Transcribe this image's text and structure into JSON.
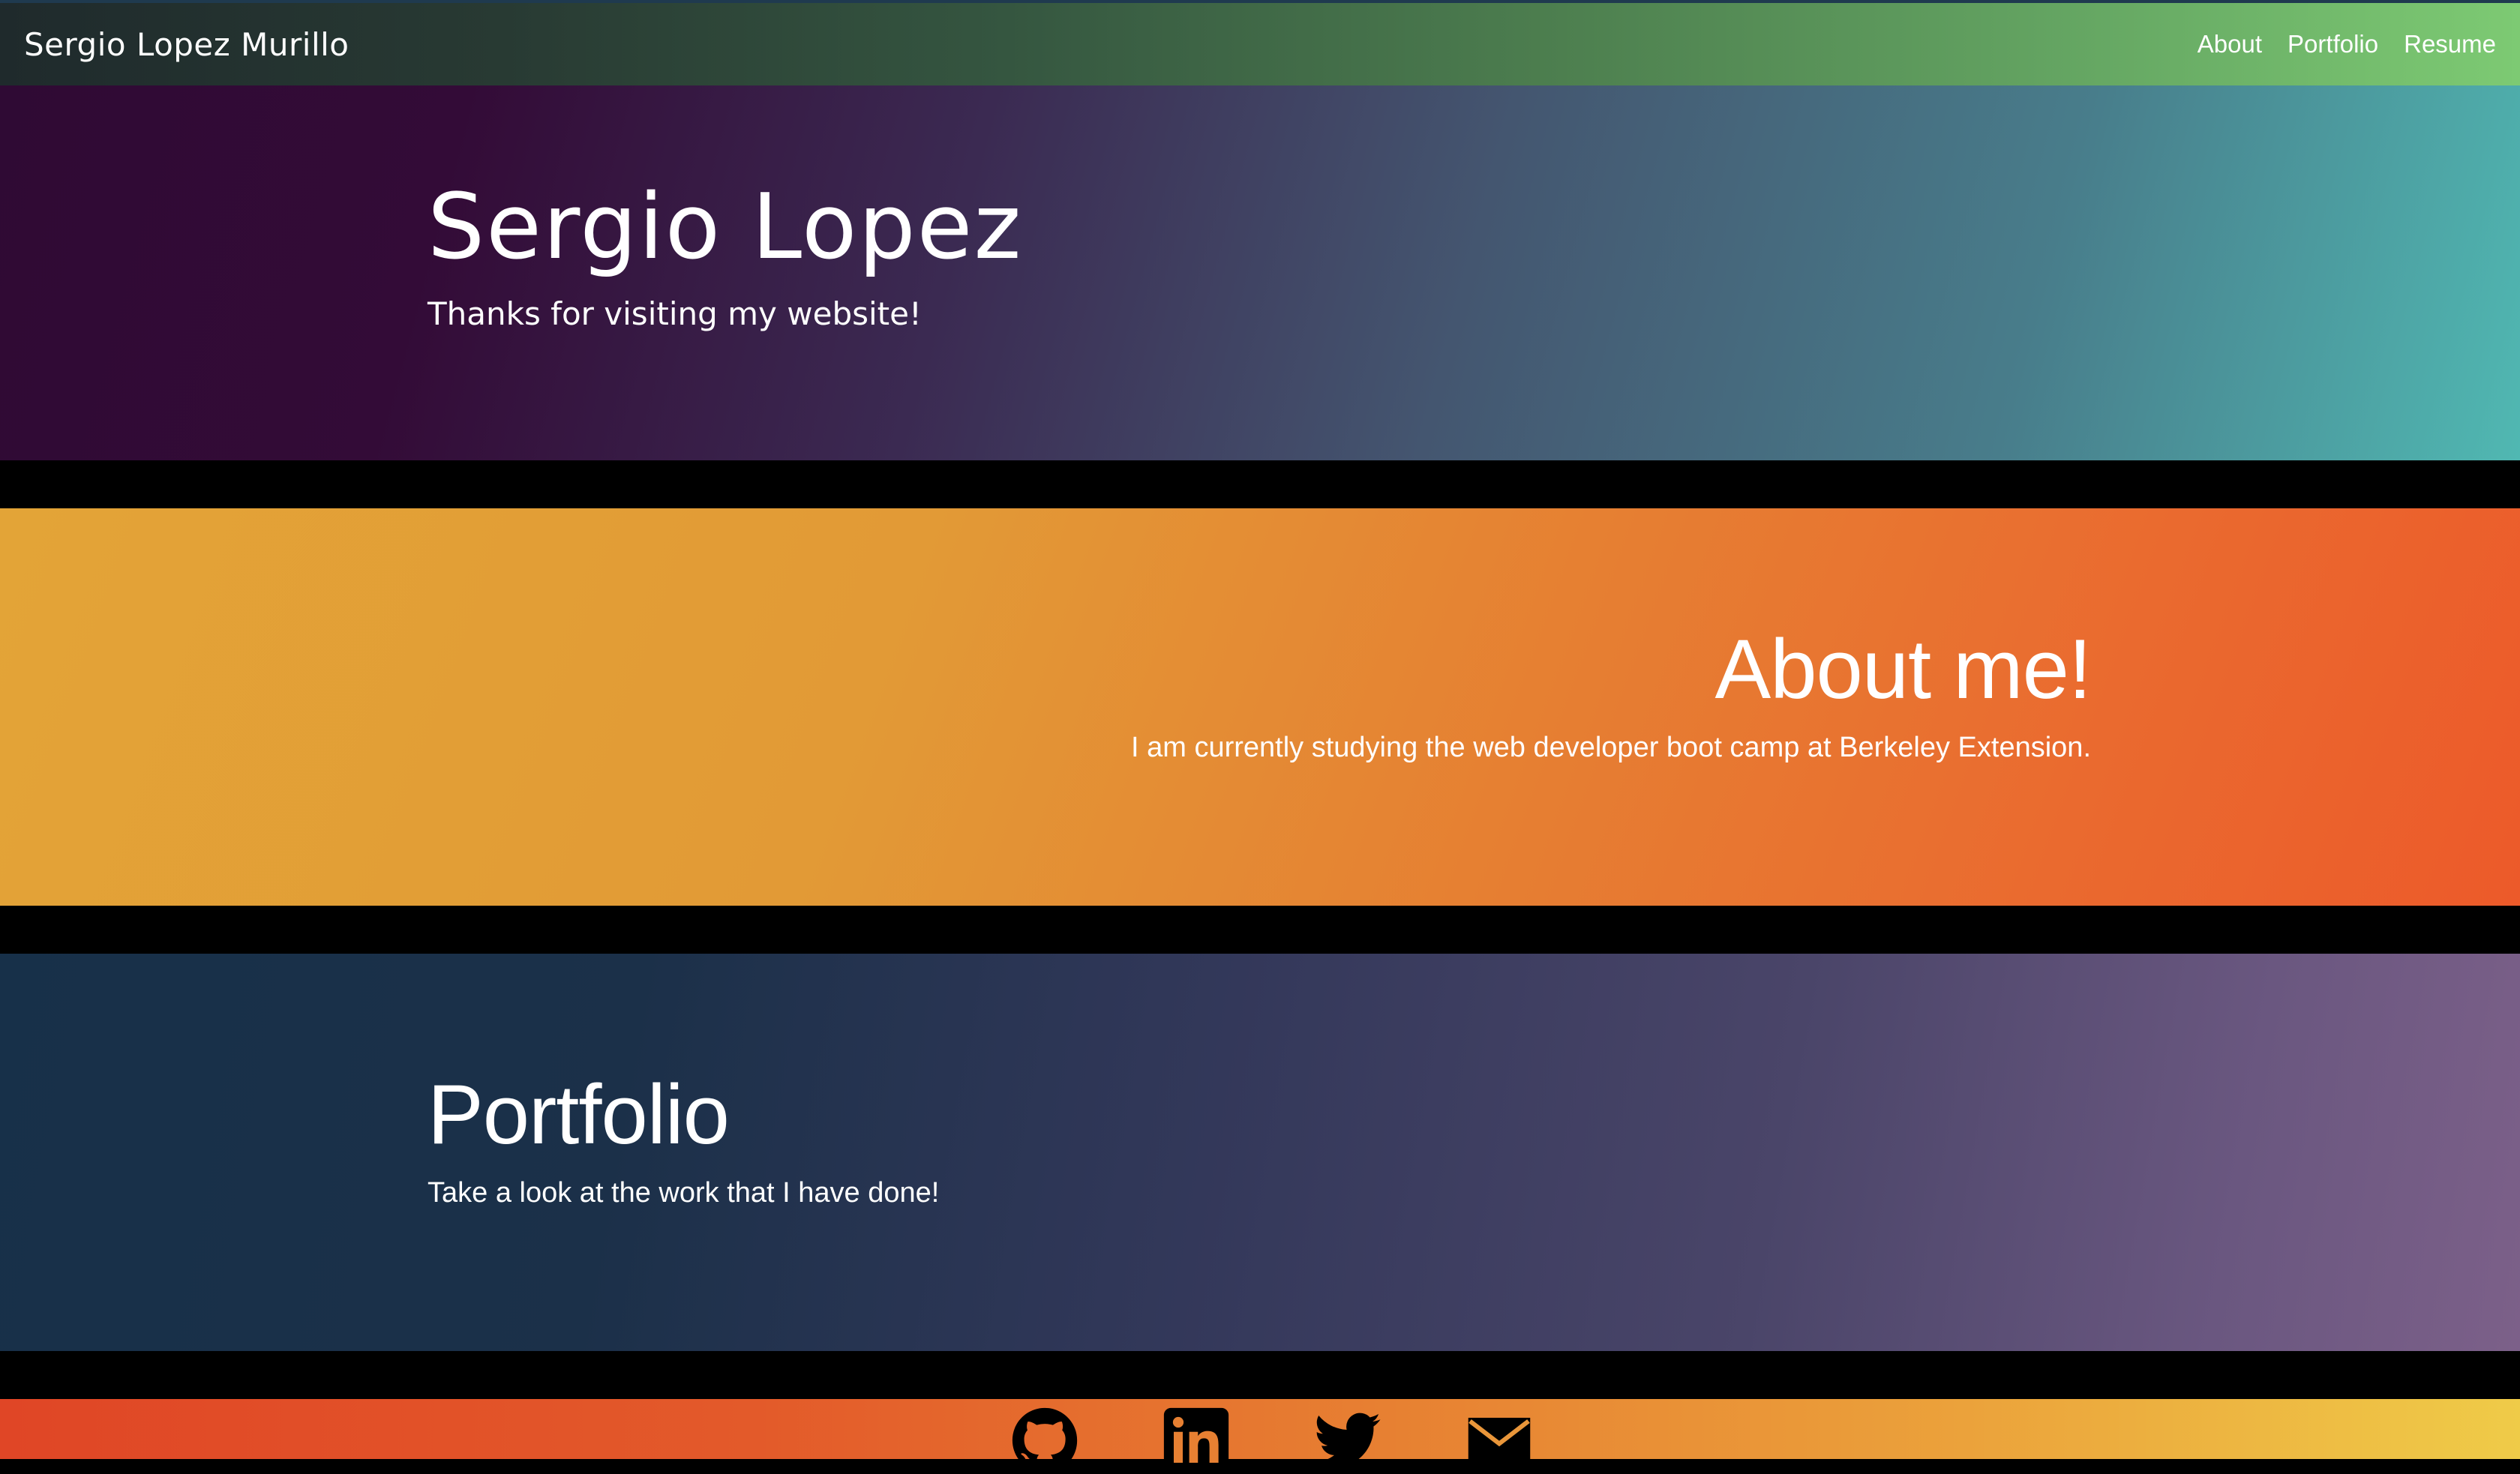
{
  "navbar": {
    "brand": "Sergio Lopez Murillo",
    "links": [
      {
        "label": "About"
      },
      {
        "label": "Portfolio"
      },
      {
        "label": "Resume"
      }
    ]
  },
  "hero": {
    "title": "Sergio Lopez",
    "subtitle": "Thanks for visiting my website!"
  },
  "about": {
    "title": "About me!",
    "text": "I am currently studying the web developer boot camp at Berkeley Extension."
  },
  "portfolio": {
    "title": "Portfolio",
    "text": "Take a look at the work that I have done!"
  },
  "footer": {
    "social": [
      {
        "icon": "github-icon"
      },
      {
        "icon": "linkedin-icon"
      },
      {
        "icon": "twitter-icon"
      },
      {
        "icon": "email-icon"
      }
    ]
  },
  "colors": {
    "navbar_start": "#1f2a2c",
    "navbar_end": "#7dca73",
    "hero_start": "#2f0a34",
    "hero_end": "#50b8b2",
    "about_start": "#e3a437",
    "about_end": "#ec5a2a",
    "portfolio_start": "#173049",
    "portfolio_end": "#7c6089",
    "footer_start": "#e04626",
    "footer_end": "#efcb48"
  }
}
